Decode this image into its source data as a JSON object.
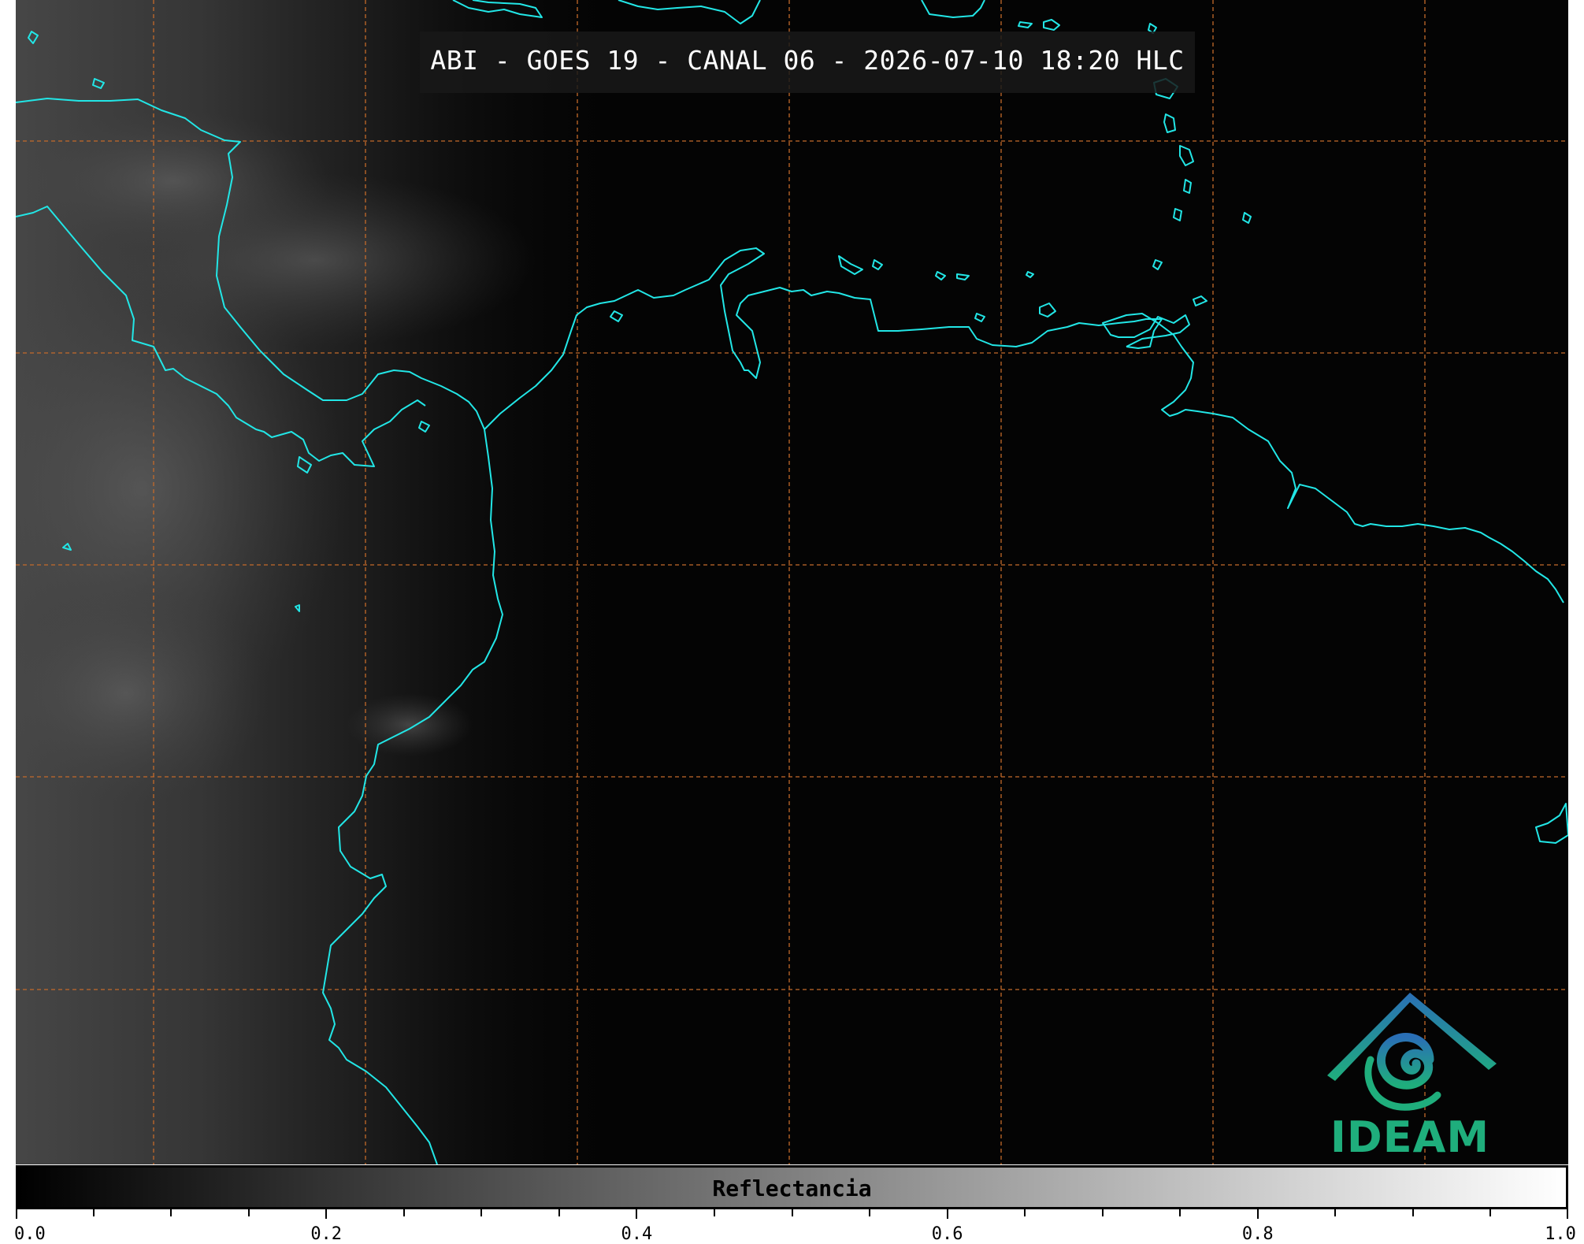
{
  "title": "ABI - GOES 19 - CANAL 06 - 2026-07-10 18:20 HLC",
  "colors": {
    "background": "#040404",
    "coastline": "#22e6e6",
    "gridlines": "#c46a2a",
    "logo_blue": "#2a6fb6",
    "logo_green": "#1fae7c"
  },
  "logo": {
    "text": "IDEAM"
  },
  "colorbar": {
    "label": "Reflectancia",
    "min": 0.0,
    "max": 1.0,
    "colormap": "gray",
    "major_ticks": [
      0.0,
      0.2,
      0.4,
      0.6,
      0.8,
      1.0
    ],
    "tick_labels": [
      "0.0",
      "0.2",
      "0.4",
      "0.6",
      "0.8",
      "1.0"
    ],
    "minor_step": 0.05
  }
}
